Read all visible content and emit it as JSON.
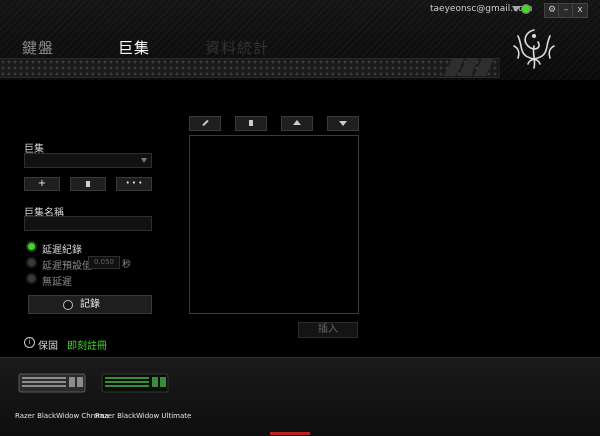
{
  "window": {
    "user_email": "taeyeonsc@gmail.com",
    "controls": [
      "⚙",
      "–",
      "x"
    ]
  },
  "tabs": [
    {
      "label": "鍵盤",
      "active": false
    },
    {
      "label": "巨集",
      "active": true
    },
    {
      "label": "資料統計",
      "active": false
    }
  ],
  "macro": {
    "section_label": "巨集",
    "select_value": "",
    "add_label": "+",
    "more_label": "• • •",
    "name_label": "巨集名稱",
    "name_value": "",
    "delay_options": [
      {
        "label": "延遲紀錄",
        "selected": true
      },
      {
        "label": "延遲預設值",
        "selected": false
      },
      {
        "label": "無延遲",
        "selected": false
      }
    ],
    "delay_value": "0.050",
    "delay_unit": "秒",
    "record_label": "記錄"
  },
  "editor": {
    "insert_label": "插入"
  },
  "footer": {
    "info_label": "保固",
    "register_label": "即刻註冊"
  },
  "devices": [
    {
      "name": "Razer BlackWidow Chroma"
    },
    {
      "name": "Razer BlackWidow Ultimate"
    }
  ],
  "colors": {
    "accent": "#44d62c",
    "background": "#000000"
  },
  "icons": [
    "razer-logo-icon",
    "chevron-down-icon",
    "pencil-icon",
    "trash-icon",
    "arrow-up-icon",
    "arrow-down-icon",
    "info-icon",
    "record-icon"
  ]
}
